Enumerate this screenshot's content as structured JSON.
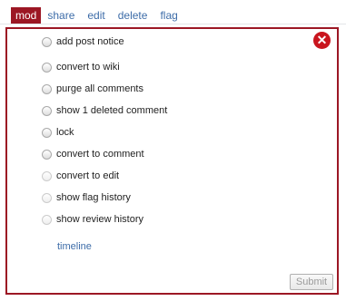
{
  "menu": {
    "mod": "mod",
    "share": "share",
    "edit": "edit",
    "delete": "delete",
    "flag": "flag"
  },
  "options": [
    {
      "label": "add post notice",
      "enabled": true
    },
    {
      "label": "convert to wiki",
      "enabled": true
    },
    {
      "label": "purge all comments",
      "enabled": true
    },
    {
      "label": "show 1 deleted comment",
      "enabled": true
    },
    {
      "label": "lock",
      "enabled": true
    },
    {
      "label": "convert to comment",
      "enabled": true
    },
    {
      "label": "convert to edit",
      "enabled": false
    },
    {
      "label": "show flag history",
      "enabled": false
    },
    {
      "label": "show review history",
      "enabled": false
    }
  ],
  "timeline": "timeline",
  "submit": "Submit",
  "close_icon": "close-icon",
  "colors": {
    "accent": "#9c1724",
    "close": "#c9151e",
    "link": "#3d6ca8"
  }
}
